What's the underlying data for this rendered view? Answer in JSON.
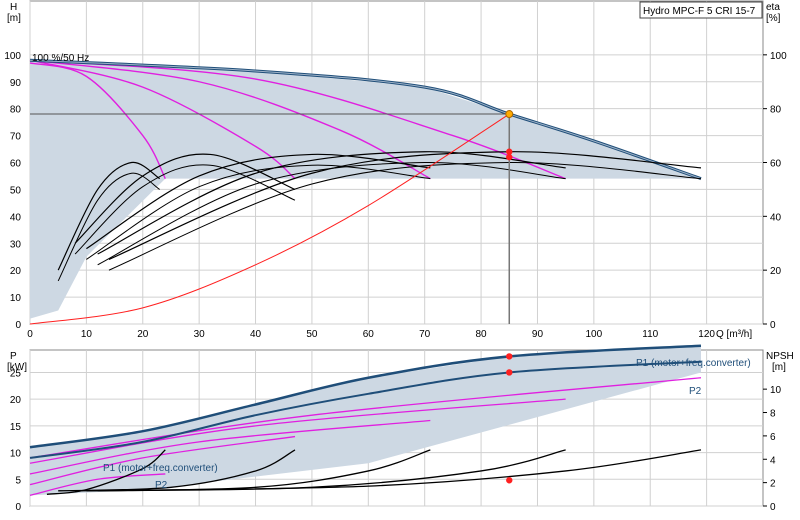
{
  "title_box": "Hydro MPC-F 5 CRI 15-7",
  "colors": {
    "envelope": "#cdd8e3",
    "envelope_stroke": "#b8c6d4",
    "curve_blue": "#1f4e79",
    "curve_magenta": "#e020e0",
    "curve_black": "#000000",
    "system_red": "#ff2020",
    "grid": "#d0d0d0",
    "marker_red": "#ff2020",
    "marker_orange": "#ffaa00"
  },
  "chart_data": [
    {
      "type": "line",
      "name": "head_efficiency",
      "ylabel_left": "H",
      "yunit_left": "[m]",
      "ylabel_right": "eta",
      "yunit_right": "[%]",
      "xlabel": "Q [m³/h]",
      "xlim": [
        0,
        130
      ],
      "ylim": [
        0,
        110
      ],
      "ylim_right": [
        0,
        130
      ],
      "grid": true,
      "x_ticks": [
        "0",
        "10",
        "20",
        "30",
        "40",
        "50",
        "60",
        "70",
        "80",
        "90",
        "100",
        "110",
        "120"
      ],
      "y_ticks": [
        "0",
        "10",
        "20",
        "30",
        "40",
        "50",
        "60",
        "70",
        "80",
        "90",
        "100"
      ],
      "y_right_ticks": [
        "0",
        "20",
        "40",
        "60",
        "80",
        "100"
      ],
      "annotation": "100 %/50 Hz",
      "duty_point": {
        "q": 85,
        "h": 78
      },
      "eta_points": [
        64,
        62
      ],
      "head_curves_magenta": [
        [
          [
            0,
            97
          ],
          [
            10,
            92
          ],
          [
            20,
            70
          ],
          [
            24,
            54
          ]
        ],
        [
          [
            0,
            98
          ],
          [
            20,
            88
          ],
          [
            40,
            66
          ],
          [
            47,
            54
          ]
        ],
        [
          [
            0,
            98
          ],
          [
            30,
            90
          ],
          [
            55,
            72
          ],
          [
            71,
            54
          ]
        ],
        [
          [
            0,
            98
          ],
          [
            40,
            91
          ],
          [
            75,
            70
          ],
          [
            95,
            54
          ]
        ]
      ],
      "head_curve_max": [
        [
          0,
          98
        ],
        [
          40,
          94
        ],
        [
          70,
          88
        ],
        [
          85,
          78
        ],
        [
          100,
          68
        ],
        [
          119,
          54
        ]
      ],
      "system_curve": [
        [
          0,
          0
        ],
        [
          20,
          6
        ],
        [
          40,
          22
        ],
        [
          60,
          44
        ],
        [
          85,
          78
        ]
      ],
      "eta_curves": [
        [
          [
            5,
            20
          ],
          [
            12,
            50
          ],
          [
            18,
            60
          ],
          [
            23,
            54
          ]
        ],
        [
          [
            8,
            30
          ],
          [
            20,
            55
          ],
          [
            32,
            63
          ],
          [
            47,
            50
          ]
        ],
        [
          [
            10,
            28
          ],
          [
            30,
            55
          ],
          [
            50,
            63
          ],
          [
            71,
            58
          ]
        ],
        [
          [
            12,
            26
          ],
          [
            40,
            56
          ],
          [
            70,
            64
          ],
          [
            95,
            58
          ]
        ],
        [
          [
            14,
            24
          ],
          [
            50,
            56
          ],
          [
            85,
            64
          ],
          [
            119,
            58
          ]
        ]
      ]
    },
    {
      "type": "line",
      "name": "power_npsh",
      "ylabel_left": "P",
      "yunit_left": "[kW]",
      "ylabel_right": "NPSH",
      "yunit_right": "[m]",
      "xlim": [
        0,
        130
      ],
      "ylim": [
        0,
        32
      ],
      "ylim_right": [
        0,
        12.8
      ],
      "grid": true,
      "y_ticks": [
        "0",
        "5",
        "10",
        "15",
        "20",
        "25"
      ],
      "y_right_ticks": [
        "0",
        "2",
        "4",
        "6",
        "8",
        "10"
      ],
      "labels": {
        "p1": "P1 (motor+freq.converter)",
        "p2": "P2",
        "p1_low": "P1 (motor+freq.converter)",
        "p2_low": "P2"
      },
      "p1_curve_max": [
        [
          0,
          11
        ],
        [
          20,
          14
        ],
        [
          40,
          19
        ],
        [
          60,
          24
        ],
        [
          85,
          28
        ],
        [
          119,
          30
        ]
      ],
      "p2_curve_max": [
        [
          0,
          9
        ],
        [
          20,
          12
        ],
        [
          40,
          17
        ],
        [
          60,
          21
        ],
        [
          85,
          25
        ],
        [
          119,
          27
        ]
      ],
      "p_curves_magenta": [
        [
          [
            0,
            2
          ],
          [
            12,
            5
          ],
          [
            24,
            6
          ]
        ],
        [
          [
            0,
            4
          ],
          [
            20,
            9
          ],
          [
            47,
            13
          ]
        ],
        [
          [
            0,
            6
          ],
          [
            30,
            12
          ],
          [
            71,
            16
          ]
        ],
        [
          [
            0,
            8
          ],
          [
            40,
            15
          ],
          [
            95,
            20
          ]
        ],
        [
          [
            0,
            9
          ],
          [
            50,
            17
          ],
          [
            119,
            24
          ]
        ]
      ],
      "npsh_curves": [
        [
          [
            3,
            1
          ],
          [
            10,
            1.4
          ],
          [
            20,
            3.2
          ],
          [
            24,
            4.8
          ]
        ],
        [
          [
            5,
            1.3
          ],
          [
            25,
            1.6
          ],
          [
            40,
            3
          ],
          [
            47,
            4.8
          ]
        ],
        [
          [
            8,
            1.3
          ],
          [
            40,
            1.6
          ],
          [
            60,
            3
          ],
          [
            71,
            4.8
          ]
        ],
        [
          [
            10,
            1.3
          ],
          [
            50,
            1.6
          ],
          [
            80,
            3
          ],
          [
            95,
            4.8
          ]
        ],
        [
          [
            12,
            1.3
          ],
          [
            60,
            1.7
          ],
          [
            95,
            3
          ],
          [
            119,
            4.8
          ]
        ]
      ],
      "duty_points": {
        "p1": 28,
        "p2": 25,
        "npsh": 2.2
      }
    }
  ]
}
